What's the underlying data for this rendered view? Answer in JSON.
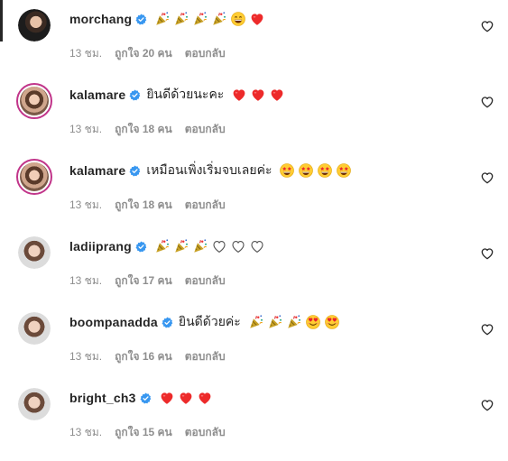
{
  "comments": [
    {
      "username": "morchang",
      "text": "",
      "emojis": [
        "party-popper",
        "party-popper",
        "party-popper",
        "party-popper",
        "grin-face",
        "red-heart"
      ],
      "time": "13 ชม.",
      "likes": "ถูกใจ 20 คน",
      "reply": "ตอบกลับ",
      "avatar": "dark"
    },
    {
      "username": "kalamare",
      "text": "ยินดีด้วยนะคะ",
      "emojis": [
        "red-heart",
        "red-heart",
        "red-heart"
      ],
      "time": "13 ชม.",
      "likes": "ถูกใจ 18 คน",
      "reply": "ตอบกลับ",
      "avatar": "ring"
    },
    {
      "username": "kalamare",
      "text": "เหมือนเพิ่งเริ่มจบเลยค่ะ",
      "emojis": [
        "star-eyes-face",
        "star-eyes-face",
        "star-eyes-face",
        "star-eyes-face"
      ],
      "time": "13 ชม.",
      "likes": "ถูกใจ 18 คน",
      "reply": "ตอบกลับ",
      "avatar": "ring"
    },
    {
      "username": "ladiiprang",
      "text": "",
      "emojis": [
        "party-popper",
        "party-popper",
        "party-popper",
        "white-heart",
        "white-heart",
        "white-heart"
      ],
      "time": "13 ชม.",
      "likes": "ถูกใจ 17 คน",
      "reply": "ตอบกลับ",
      "avatar": "light"
    },
    {
      "username": "boompanadda",
      "text": "ยินดีด้วยค่ะ",
      "emojis": [
        "party-popper",
        "party-popper",
        "party-popper",
        "heart-eyes-face",
        "heart-eyes-face"
      ],
      "time": "13 ชม.",
      "likes": "ถูกใจ 16 คน",
      "reply": "ตอบกลับ",
      "avatar": "light"
    },
    {
      "username": "bright_ch3",
      "text": "",
      "emojis": [
        "red-heart",
        "red-heart",
        "red-heart"
      ],
      "time": "13 ชม.",
      "likes": "ถูกใจ 15 คน",
      "reply": "ตอบกลับ",
      "avatar": "light"
    }
  ],
  "colors": {
    "verified": "#3897f0",
    "heart_red": "#ed2a2a",
    "meta_gray": "#8e8e8e",
    "avatar_ring": "#c1358a"
  }
}
